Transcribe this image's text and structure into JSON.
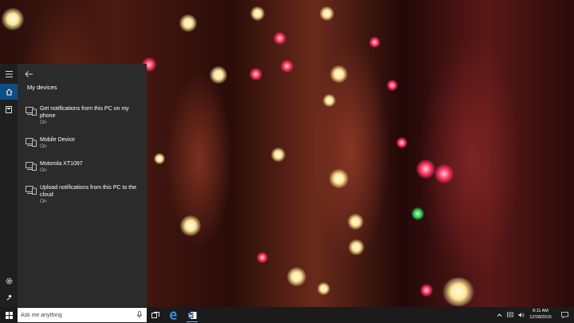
{
  "cortana": {
    "panel_title": "My devices",
    "devices": [
      {
        "name": "Get notifications from this PC on my phone",
        "status": "On"
      },
      {
        "name": "Mobile Device",
        "status": "On"
      },
      {
        "name": "Motorola XT1097",
        "status": "On"
      },
      {
        "name": "Upload notifications from this PC to the cloud",
        "status": "On"
      }
    ],
    "rail_icons": [
      "hamburger-icon",
      "home-icon",
      "notebook-icon",
      "settings-icon",
      "feedback-icon"
    ]
  },
  "taskbar": {
    "search_placeholder": "Ask me anything",
    "clock_time": "8:11 AM",
    "clock_date": "12/28/2016",
    "apps": [
      "task-view-icon",
      "edge-icon",
      "word-icon"
    ]
  },
  "colors": {
    "accent": "#0f4e82",
    "panel_bg": "#2b2b2b",
    "rail_bg": "#1f1f1f",
    "taskbar_bg": "#1b1b1b"
  }
}
